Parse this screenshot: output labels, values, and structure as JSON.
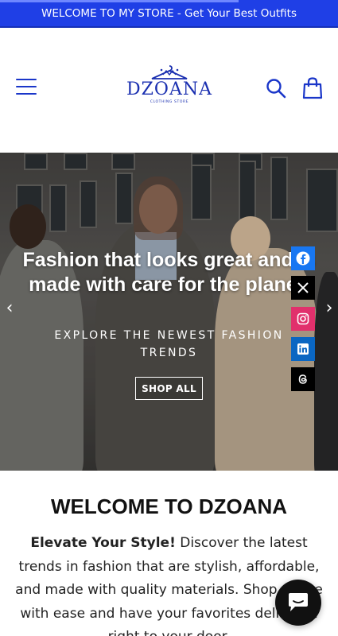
{
  "announcement": {
    "text": "WELCOME TO MY STORE - Get Your Best Outfits"
  },
  "header": {
    "logo_word": "DZOANA",
    "logo_sub": "CLOTHING STORE",
    "menu_icon": "hamburger-menu-icon",
    "search_icon": "search-icon",
    "cart_icon": "shopping-bag-icon",
    "accent_color": "#1a36c9"
  },
  "hero": {
    "title": "Fashion that looks great and is made with care for the planet.",
    "subtitle": "EXPLORE THE NEWEST FASHION TRENDS",
    "button_label": "SHOP ALL",
    "prev_arrow": "‹",
    "next_arrow": "›"
  },
  "social": [
    {
      "name": "facebook-icon",
      "color": "#1877f2"
    },
    {
      "name": "x-icon",
      "color": "#000000"
    },
    {
      "name": "instagram-icon",
      "color": "#e1306c"
    },
    {
      "name": "linkedin-icon",
      "color": "#0a66c2"
    },
    {
      "name": "threads-icon",
      "color": "#000000"
    }
  ],
  "welcome": {
    "heading": "WELCOME TO DZOANA",
    "lead": "Elevate Your Style!",
    "body": "Discover the latest trends in fashion that are stylish, affordable, and made with quality materials. Shop online with ease and have your favorites delivered right to your door."
  },
  "chat": {
    "icon": "chat-bubble-icon"
  }
}
